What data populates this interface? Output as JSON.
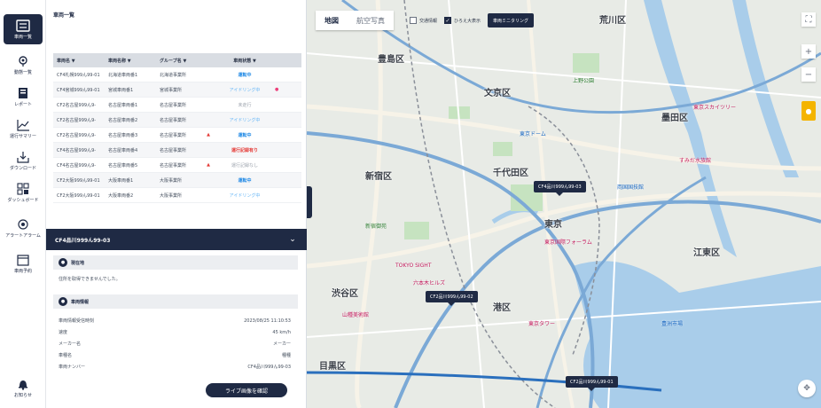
{
  "rail": {
    "items": [
      {
        "label": "車両一覧",
        "icon": "vehicle-list-icon"
      },
      {
        "label": "動態一覧",
        "icon": "location-icon"
      },
      {
        "label": "レポート",
        "icon": "report-icon"
      },
      {
        "label": "運行サマリー",
        "icon": "chart-icon"
      },
      {
        "label": "ダウンロード",
        "icon": "download-icon"
      },
      {
        "label": "ダッシュボード",
        "icon": "dashboard-icon"
      },
      {
        "label": "アラートアラーム",
        "icon": "alert-icon"
      },
      {
        "label": "車両予約",
        "icon": "calendar-icon"
      },
      {
        "label": "お知らせ",
        "icon": "bell-icon"
      }
    ]
  },
  "panel": {
    "title": "車両一覧",
    "columns": [
      "車両名 ▼",
      "車両名称 ▼",
      "グループ名 ▼",
      "車両状態 ▼"
    ],
    "rows": [
      {
        "id": "CF4札幌999ん99-01",
        "name": "北海道車両番1",
        "group": "北海道事業所",
        "alert": "",
        "status": "運転中",
        "status_type": "blue",
        "pin": ""
      },
      {
        "id": "CF4宮城999ん99-01",
        "name": "宮城車両番1",
        "group": "宮城事業所",
        "alert": "",
        "status": "アイドリング中",
        "status_type": "lightblue",
        "pin": "●"
      },
      {
        "id": "CF2名古屋999ん9-",
        "name": "名古屋車両番1",
        "group": "名古屋事業所",
        "alert": "",
        "status": "未走行",
        "status_type": "gray",
        "pin": ""
      },
      {
        "id": "CF2名古屋999ん9-",
        "name": "名古屋車両番2",
        "group": "名古屋事業所",
        "alert": "",
        "status": "アイドリング中",
        "status_type": "lightblue",
        "pin": ""
      },
      {
        "id": "CF2名古屋999ん9-",
        "name": "名古屋車両番3",
        "group": "名古屋事業所",
        "alert": "▲",
        "status": "運転中",
        "status_type": "blue",
        "pin": ""
      },
      {
        "id": "CF4名古屋999ん9-",
        "name": "名古屋車両番4",
        "group": "名古屋事業所",
        "alert": "",
        "status": "運行記録有り",
        "status_type": "red",
        "pin": ""
      },
      {
        "id": "CF4名古屋999ん9-",
        "name": "名古屋車両番5",
        "group": "名古屋事業所",
        "alert": "▲",
        "status": "運行記録なし",
        "status_type": "gray",
        "pin": ""
      },
      {
        "id": "CF2大阪999ん99-01",
        "name": "大阪車両番1",
        "group": "大阪事業所",
        "alert": "",
        "status": "運転中",
        "status_type": "blue",
        "pin": ""
      },
      {
        "id": "CF2大阪999ん99-01",
        "name": "大阪車両番2",
        "group": "大阪事業所",
        "alert": "",
        "status": "アイドリング中",
        "status_type": "lightblue",
        "pin": ""
      }
    ]
  },
  "detail": {
    "title": "CF4品川999ん99-03",
    "section_location": "現在地",
    "location_text": "住所を取得できませんでした。",
    "section_vehicle": "車両情報",
    "fields": [
      {
        "key": "車両情報受信時刻",
        "value": "2023/08/25 11:10:53"
      },
      {
        "key": "速度",
        "value": "45 km/h"
      },
      {
        "key": "メーカー名",
        "value": "メーカー"
      },
      {
        "key": "車種名",
        "value": "種種"
      },
      {
        "key": "車両ナンバー",
        "value": "CF4品川999ん99-03"
      }
    ],
    "live_button": "ライブ画像を確認"
  },
  "map": {
    "tabs": [
      "地図",
      "航空写真"
    ],
    "overlays": [
      {
        "label": "交通情報",
        "checked": false
      },
      {
        "label": "ひろえ大表示",
        "checked": true
      }
    ],
    "monitor_button": "車両ミニタリング",
    "wards": [
      "豊島区",
      "荒川区",
      "文京区",
      "墨田区",
      "新宿区",
      "千代田区",
      "東京",
      "江東区",
      "渋谷区",
      "港区",
      "目黒区"
    ],
    "pois": [
      "東京スカイツリー",
      "東京ドーム",
      "すみだ水族館",
      "東京国際フォーラム",
      "TOKYO SIGHT",
      "六本木ヒルズ",
      "山種美術館",
      "東京タワー",
      "新宿御苑",
      "上野公園",
      "両国国技館",
      "豊洲市場"
    ],
    "vehicle_tags": [
      "CF4品川999ん99-03",
      "CF2品川999ん99-02",
      "CF2品川999ん99-01"
    ]
  }
}
